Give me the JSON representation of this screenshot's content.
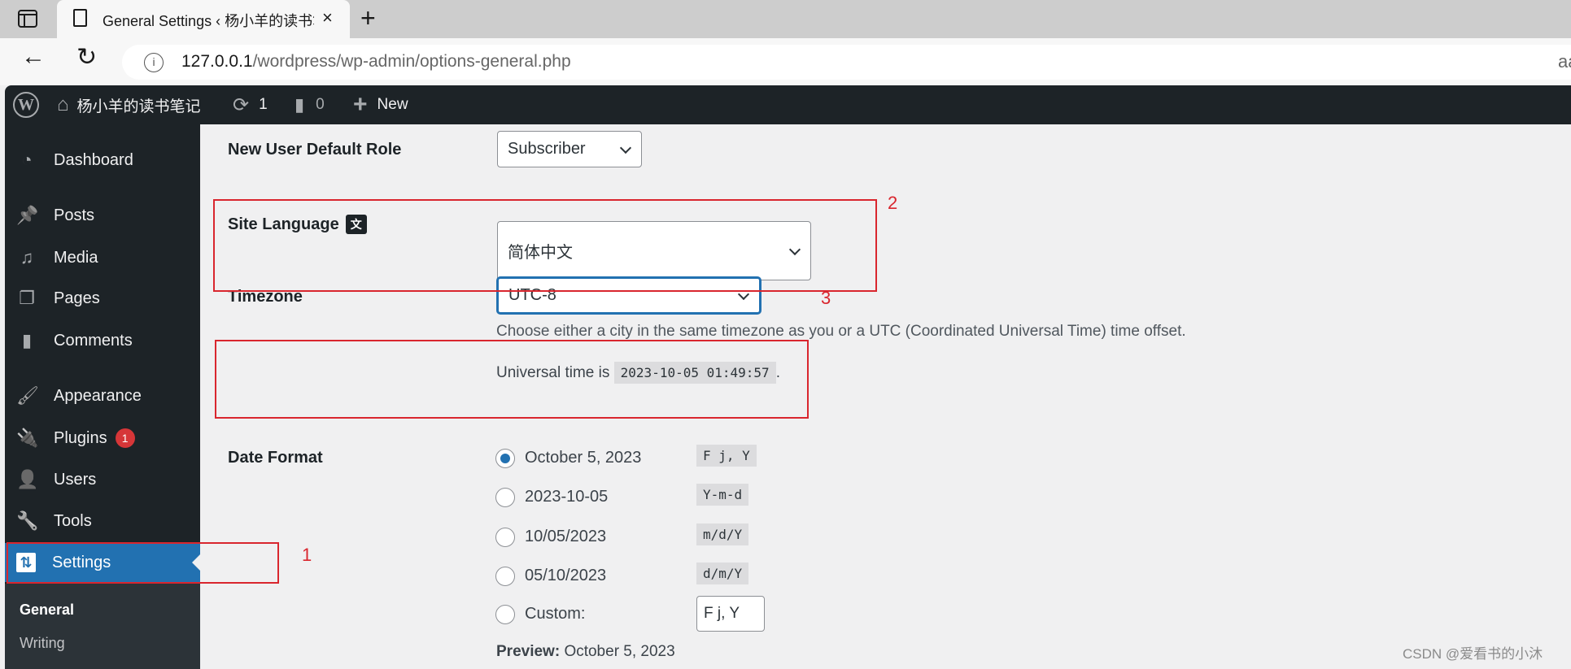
{
  "browser": {
    "tab_title": "General Settings ‹ 杨小羊的读书笔记",
    "tab_close": "×",
    "new_tab": "+",
    "back": "←",
    "reload": "↻",
    "info": "i",
    "url_host": "127.0.0.1",
    "url_path": "/wordpress/wp-admin/options-general.php",
    "reader_icon": "aa"
  },
  "adminbar": {
    "wp_logo": "W",
    "site_icon": "⌂",
    "site_name": "杨小羊的读书笔记",
    "updates_icon": "⟳",
    "updates_count": "1",
    "comments_icon": "▮",
    "comments_count": "0",
    "new_icon": "+",
    "new_label": "New"
  },
  "sidebar": {
    "items": [
      {
        "label": "Dashboard",
        "icon": "◔"
      },
      {
        "label": "Posts",
        "icon": "📌"
      },
      {
        "label": "Media",
        "icon": "♫"
      },
      {
        "label": "Pages",
        "icon": "❐"
      },
      {
        "label": "Comments",
        "icon": "▮"
      },
      {
        "label": "Appearance",
        "icon": "🖌"
      },
      {
        "label": "Plugins",
        "icon": "🔌",
        "badge": "1"
      },
      {
        "label": "Users",
        "icon": "👤"
      },
      {
        "label": "Tools",
        "icon": "🔧"
      },
      {
        "label": "Settings",
        "icon": "⇅"
      }
    ],
    "submenu": [
      "General",
      "Writing"
    ]
  },
  "form": {
    "default_role": {
      "label": "New User Default Role",
      "value": "Subscriber"
    },
    "site_language": {
      "label": "Site Language",
      "icon": "文",
      "value": "简体中文"
    },
    "timezone": {
      "label": "Timezone",
      "value": "UTC-8",
      "description": "Choose either a city in the same timezone as you or a UTC (Coordinated Universal Time) time offset.",
      "universal_prefix": "Universal time is",
      "universal_time": "2023-10-05 01:49:57",
      "universal_suffix": "."
    },
    "date_format": {
      "label": "Date Format",
      "options": [
        {
          "text": "October 5, 2023",
          "code": "F j, Y",
          "checked": true
        },
        {
          "text": "2023-10-05",
          "code": "Y-m-d",
          "checked": false
        },
        {
          "text": "10/05/2023",
          "code": "m/d/Y",
          "checked": false
        },
        {
          "text": "05/10/2023",
          "code": "d/m/Y",
          "checked": false
        },
        {
          "text": "Custom:",
          "checked": false
        }
      ],
      "custom_value": "F j, Y",
      "preview_label": "Preview:",
      "preview_value": "October 5, 2023"
    }
  },
  "annotations": [
    "1",
    "2",
    "3"
  ],
  "watermark": "CSDN @爱看书的小沐",
  "colors": {
    "accent": "#2271b1",
    "adminbar": "#1d2327",
    "annotation": "#d9262e",
    "badge": "#d63638"
  }
}
